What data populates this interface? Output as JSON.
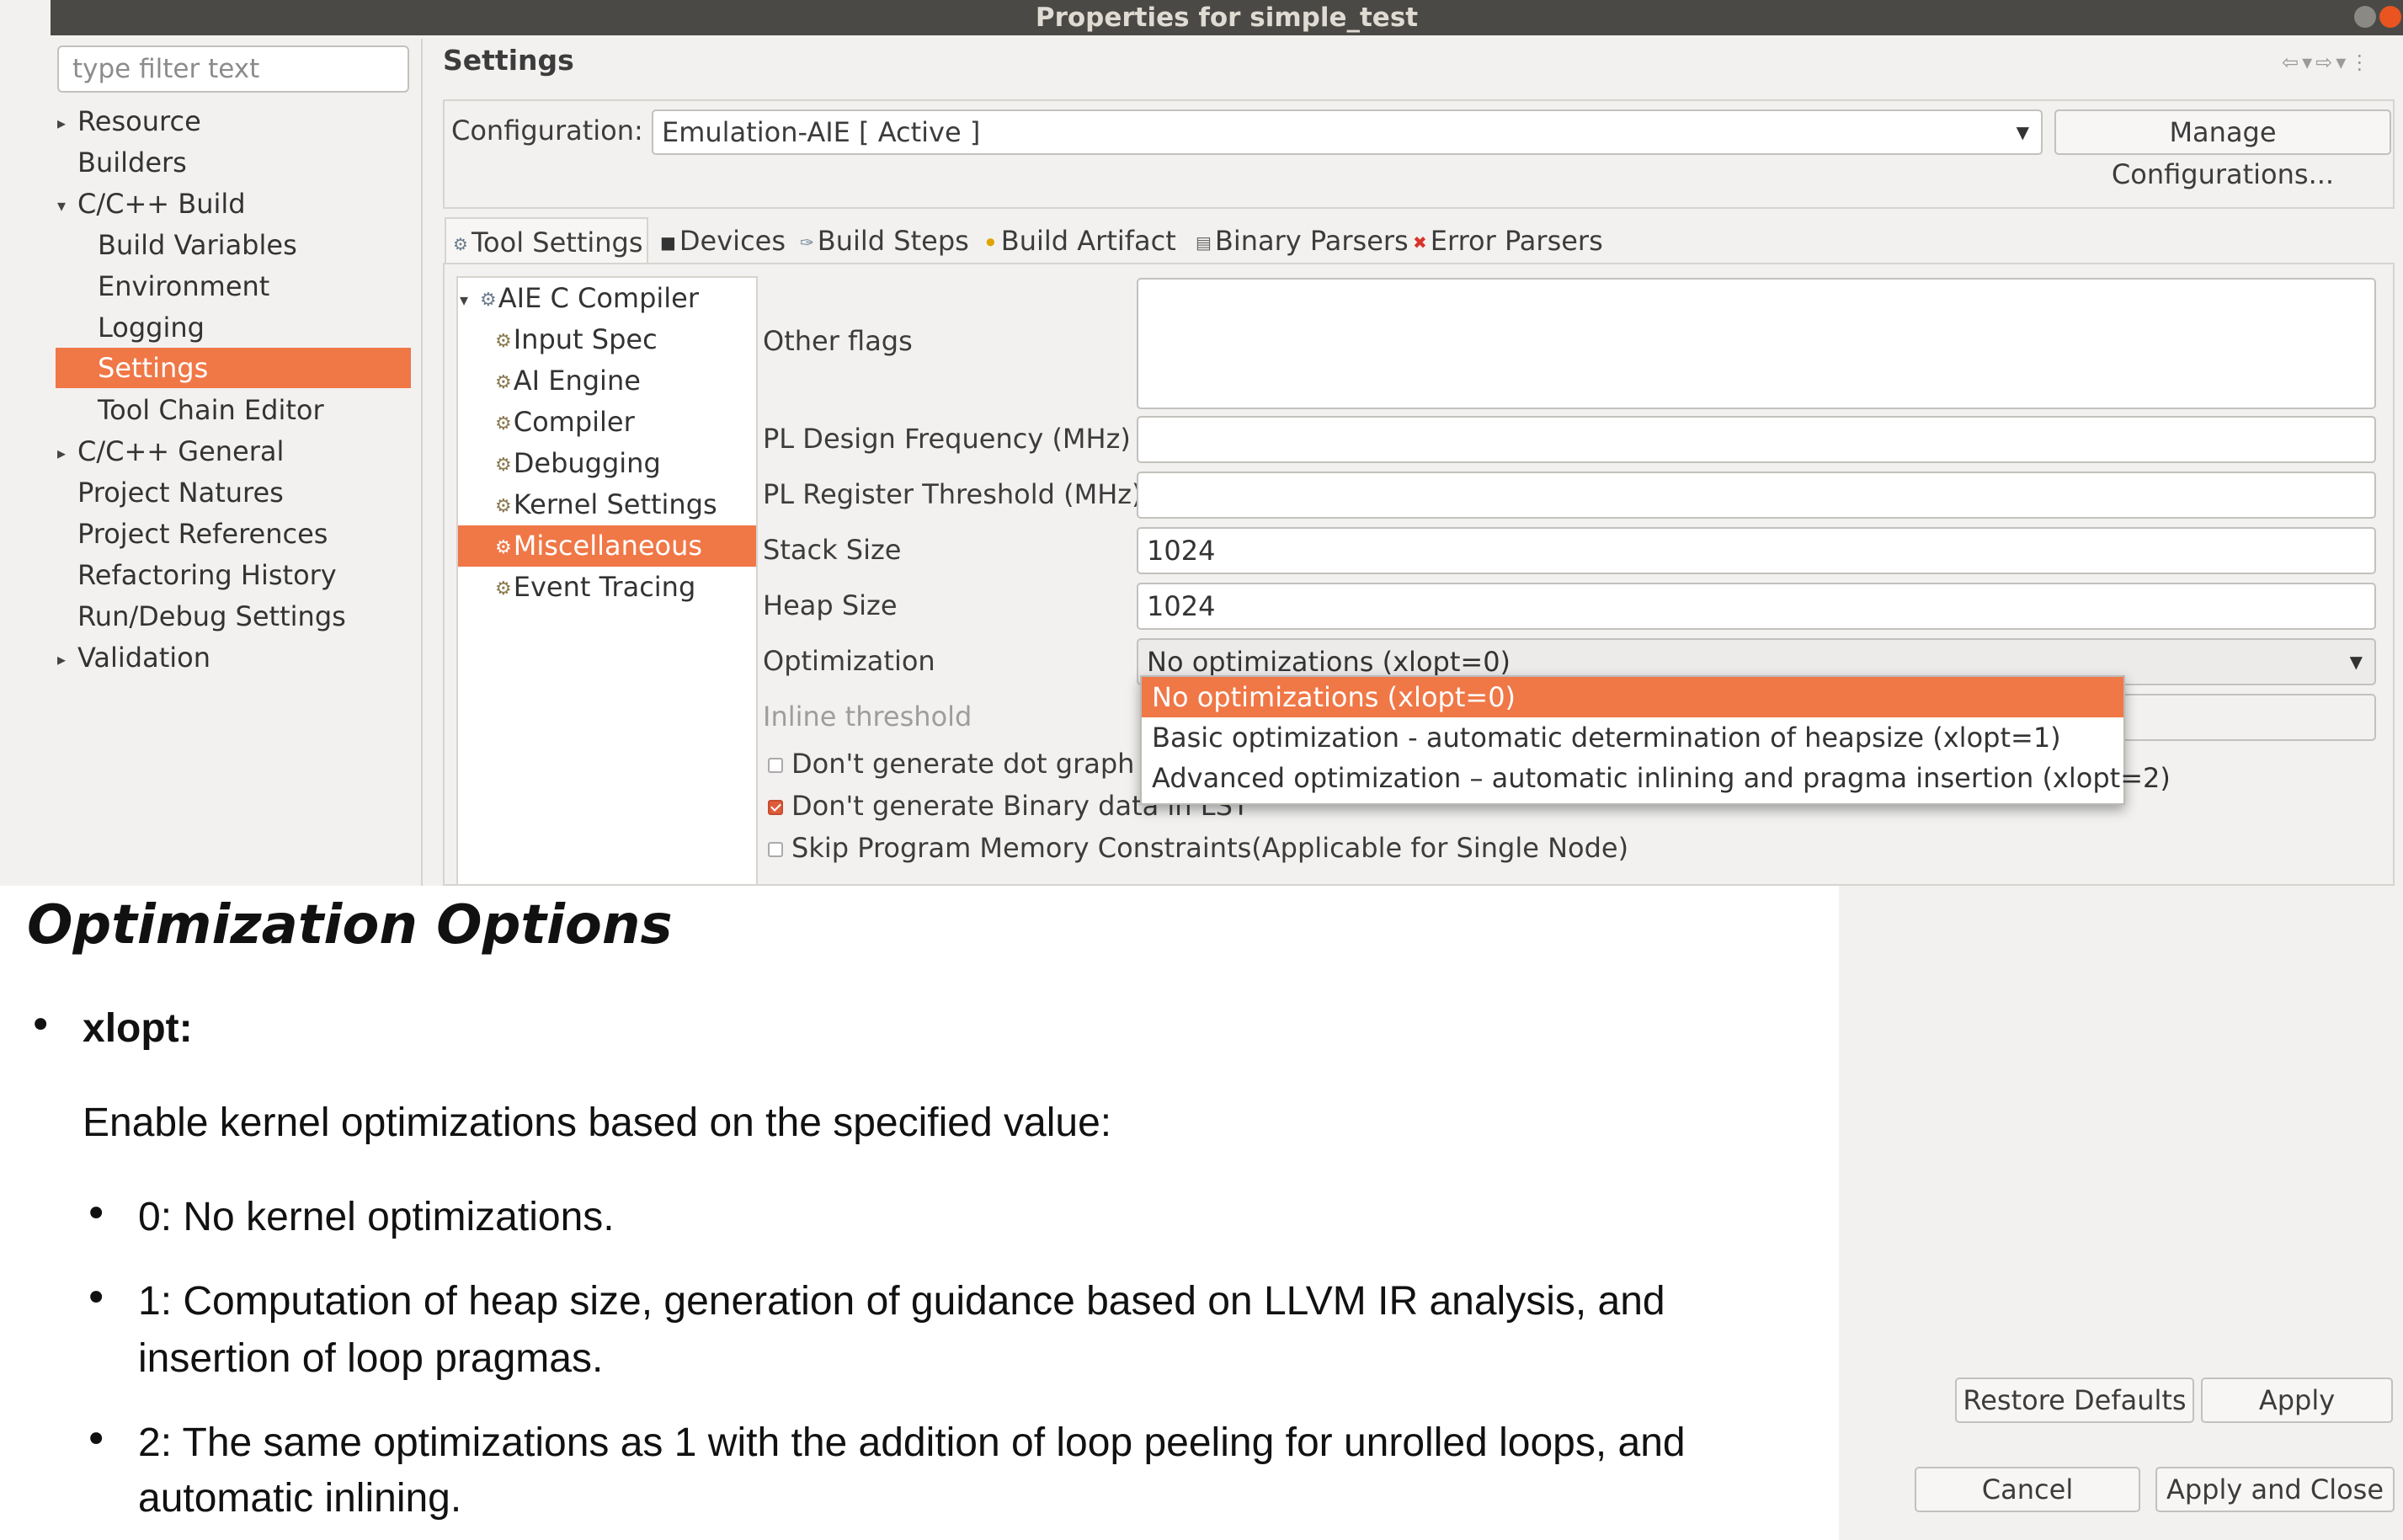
{
  "window": {
    "title": "Properties for simple_test"
  },
  "sidebar": {
    "filter_placeholder": "type filter text",
    "items": [
      {
        "label": "Resource"
      },
      {
        "label": "Builders"
      },
      {
        "label": "C/C++ Build"
      },
      {
        "label": "Build Variables"
      },
      {
        "label": "Environment"
      },
      {
        "label": "Logging"
      },
      {
        "label": "Settings"
      },
      {
        "label": "Tool Chain Editor"
      },
      {
        "label": "C/C++ General"
      },
      {
        "label": "Project Natures"
      },
      {
        "label": "Project References"
      },
      {
        "label": "Refactoring History"
      },
      {
        "label": "Run/Debug Settings"
      },
      {
        "label": "Validation"
      }
    ]
  },
  "header": {
    "title": "Settings"
  },
  "config": {
    "label": "Configuration:",
    "value": "Emulation-AIE  [ Active ]",
    "manage_label": "Manage Configurations..."
  },
  "tabs": [
    {
      "label": "Tool Settings"
    },
    {
      "label": "Devices"
    },
    {
      "label": "Build Steps"
    },
    {
      "label": "Build Artifact"
    },
    {
      "label": "Binary Parsers"
    },
    {
      "label": "Error Parsers"
    }
  ],
  "tool_tree": {
    "root": "AIE C Compiler",
    "children": [
      "Input Spec",
      "AI Engine",
      "Compiler",
      "Debugging",
      "Kernel Settings",
      "Miscellaneous",
      "Event Tracing"
    ]
  },
  "form": {
    "other_flags_label": "Other flags",
    "other_flags_value": "",
    "pl_freq_label": "PL Design Frequency (MHz)",
    "pl_freq_value": "",
    "pl_reg_label": "PL Register Threshold (MHz)",
    "pl_reg_value": "",
    "stack_label": "Stack Size",
    "stack_value": "1024",
    "heap_label": "Heap Size",
    "heap_value": "1024",
    "opt_label": "Optimization",
    "opt_value": "No optimizations (xlopt=0)",
    "inline_label": "Inline threshold",
    "check1_label": "Don't generate dot graph fi",
    "check1_checked": false,
    "check2_label": "Don't generate Binary data in LST",
    "check2_checked": true,
    "check3_label": "Skip Program Memory Constraints(Applicable for Single Node)",
    "check3_checked": false
  },
  "dropdown_options": [
    "No optimizations (xlopt=0)",
    "Basic optimization - automatic determination of heapsize (xlopt=1)",
    "Advanced optimization – automatic inlining and pragma insertion (xlopt=2)"
  ],
  "buttons": {
    "restore": "Restore Defaults",
    "apply": "Apply",
    "cancel": "Cancel",
    "apply_close": "Apply and Close"
  },
  "doc": {
    "title": "Optimization Options",
    "item": "xlopt:",
    "intro": "Enable kernel optimizations based on the specified value:",
    "bullet0": "0: No kernel optimizations.",
    "bullet1_line1": "1: Computation of heap size, generation of guidance based on LLVM IR analysis, and",
    "bullet1_line2": "insertion of loop pragmas.",
    "bullet2_line1": "2: The same optimizations as 1 with the addition of loop peeling for unrolled loops, and",
    "bullet2_line2": "automatic inlining."
  }
}
